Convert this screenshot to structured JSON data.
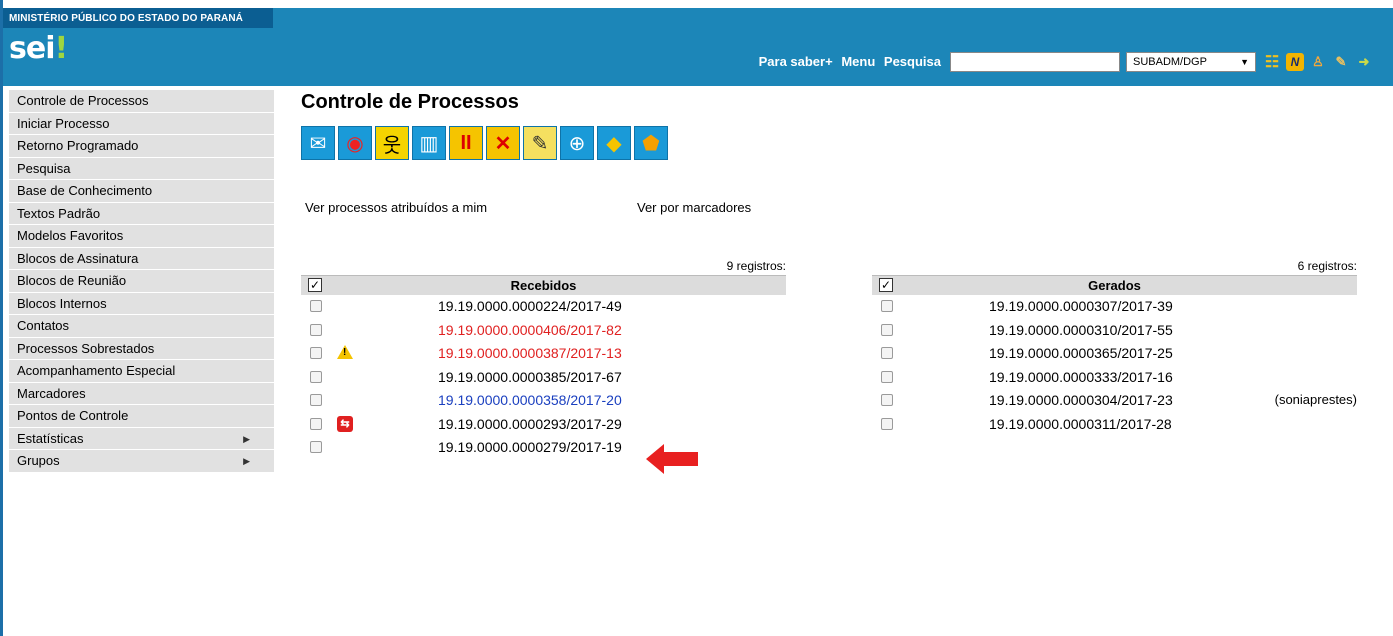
{
  "header": {
    "org_name": "MINISTÉRIO PÚBLICO DO ESTADO DO PARANÁ",
    "logo": "sei",
    "logo_dot": "!",
    "nav": [
      "Para saber+",
      "Menu",
      "Pesquisa"
    ],
    "search_value": "",
    "unit_selected": "SUBADM/DGP",
    "icons": [
      "list-icon",
      "n-icon",
      "user-icon",
      "wrench-icon",
      "exit-icon"
    ]
  },
  "sidebar": {
    "items": [
      {
        "label": "Controle de Processos",
        "submenu": false
      },
      {
        "label": "Iniciar Processo",
        "submenu": false
      },
      {
        "label": "Retorno Programado",
        "submenu": false
      },
      {
        "label": "Pesquisa",
        "submenu": false
      },
      {
        "label": "Base de Conhecimento",
        "submenu": false
      },
      {
        "label": "Textos Padrão",
        "submenu": false
      },
      {
        "label": "Modelos Favoritos",
        "submenu": false
      },
      {
        "label": "Blocos de Assinatura",
        "submenu": false
      },
      {
        "label": "Blocos de Reunião",
        "submenu": false
      },
      {
        "label": "Blocos Internos",
        "submenu": false
      },
      {
        "label": "Contatos",
        "submenu": false
      },
      {
        "label": "Processos Sobrestados",
        "submenu": false
      },
      {
        "label": "Acompanhamento Especial",
        "submenu": false
      },
      {
        "label": "Marcadores",
        "submenu": false
      },
      {
        "label": "Pontos de Controle",
        "submenu": false
      },
      {
        "label": "Estatísticas",
        "submenu": true
      },
      {
        "label": "Grupos",
        "submenu": true
      }
    ]
  },
  "main": {
    "title": "Controle de Processos",
    "toolbar_icons": [
      "send-icon",
      "globe-icon",
      "assign-user-icon",
      "library-icon",
      "pause-icon",
      "close-folder-icon",
      "note-icon",
      "new-document-icon",
      "tag-icon",
      "shield-icon"
    ],
    "link_assigned": "Ver processos atribuídos a mim",
    "link_markers": "Ver por marcadores"
  },
  "received": {
    "count": "9 registros:",
    "header": "Recebidos",
    "rows": [
      {
        "number": "19.19.0000.0000224/2017-49",
        "color": "#000000",
        "icon": ""
      },
      {
        "number": "19.19.0000.0000406/2017-82",
        "color": "#e02020",
        "icon": ""
      },
      {
        "number": "19.19.0000.0000387/2017-13",
        "color": "#e02020",
        "icon": "warning-icon"
      },
      {
        "number": "19.19.0000.0000385/2017-67",
        "color": "#000000",
        "icon": ""
      },
      {
        "number": "19.19.0000.0000358/2017-20",
        "color": "#1a3fbf",
        "icon": ""
      },
      {
        "number": "19.19.0000.0000293/2017-29",
        "color": "#000000",
        "icon": "swap-icon"
      },
      {
        "number": "19.19.0000.0000279/2017-19",
        "color": "#000000",
        "icon": ""
      }
    ]
  },
  "generated": {
    "count": "6 registros:",
    "header": "Gerados",
    "rows": [
      {
        "number": "19.19.0000.0000307/2017-39",
        "note": ""
      },
      {
        "number": "19.19.0000.0000310/2017-55",
        "note": ""
      },
      {
        "number": "19.19.0000.0000365/2017-25",
        "note": ""
      },
      {
        "number": "19.19.0000.0000333/2017-16",
        "note": ""
      },
      {
        "number": "19.19.0000.0000304/2017-23",
        "note": "(soniaprestes)"
      },
      {
        "number": "19.19.0000.0000311/2017-28",
        "note": ""
      }
    ]
  },
  "colors": {
    "header_bg": "#1c86b8",
    "org_strip": "#0b5e92",
    "toolbar_btn": "#1a9ad8",
    "sidebar_bg": "#e1e1e1",
    "annotation_arrow": "#e82020"
  }
}
